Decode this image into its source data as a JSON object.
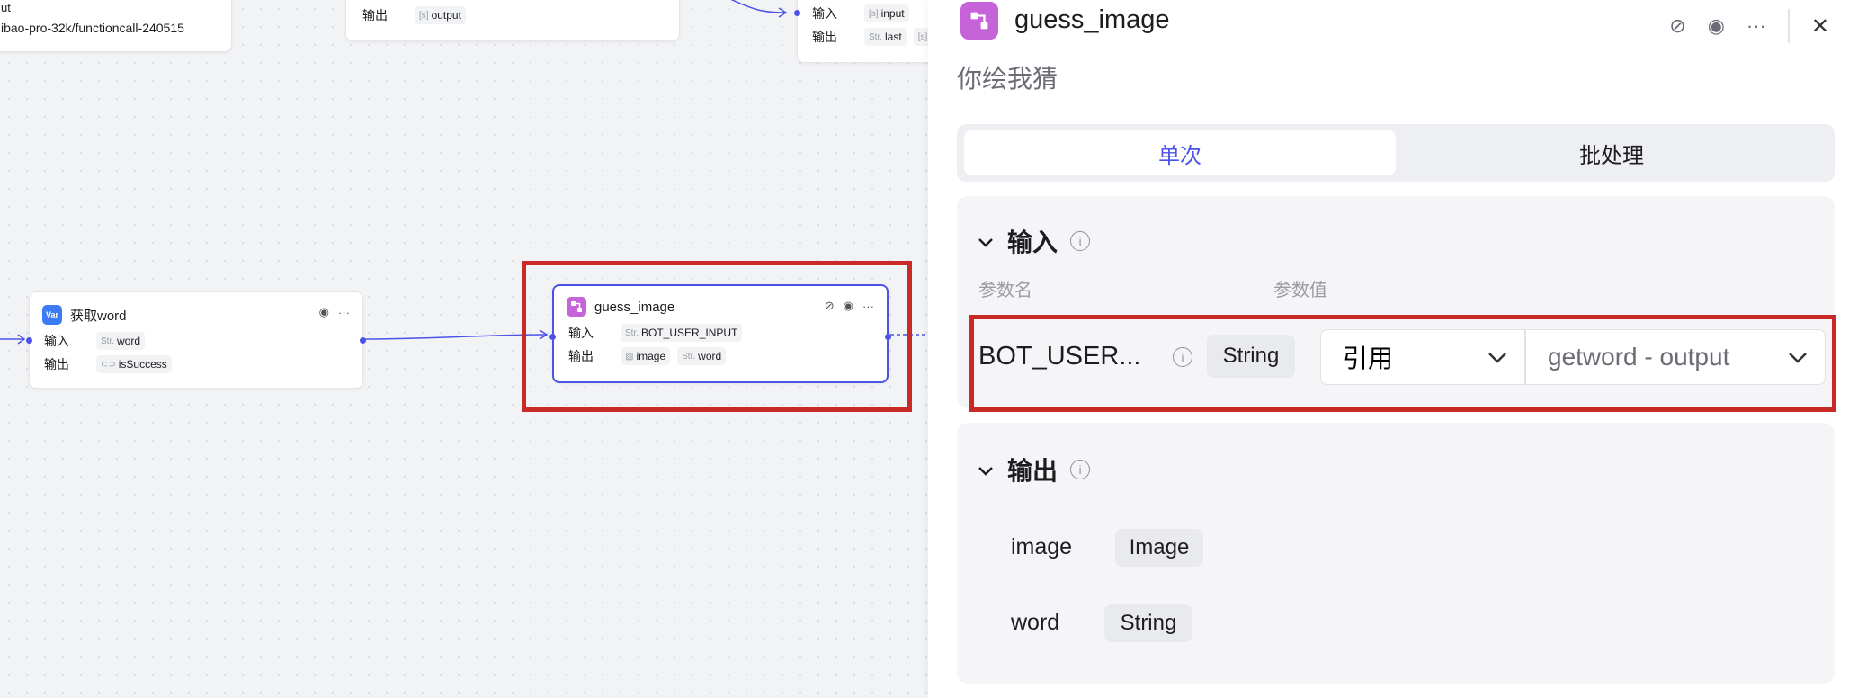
{
  "canvas": {
    "node_top_left": {
      "text": "ibao-pro-32k/functioncall-240515",
      "partial": "ut"
    },
    "node_top_mid": {
      "out_label": "输出",
      "out_value": "output"
    },
    "node_top_right": {
      "in_label": "输入",
      "in_value": "input",
      "out_label": "输出",
      "out_value_1": "last",
      "out_value_2": "a"
    },
    "node_getword": {
      "badge": "Var",
      "title": "获取word",
      "in_label": "输入",
      "in_type": "Str.",
      "in_value": "word",
      "out_label": "输出",
      "out_value": "isSuccess"
    },
    "node_guess": {
      "title": "guess_image",
      "in_label": "输入",
      "in_type": "Str.",
      "in_value": "BOT_USER_INPUT",
      "out_label": "输出",
      "out_value_1": "image",
      "out_type_2": "Str.",
      "out_value_2": "word"
    },
    "type_prefix": "Str."
  },
  "panel": {
    "title": "guess_image",
    "description": "你绘我猜",
    "tabs": {
      "single": "单次",
      "batch": "批处理"
    },
    "input_section": {
      "title": "输入",
      "col_name": "参数名",
      "col_value": "参数值",
      "param_name": "BOT_USER...",
      "param_type": "String",
      "mode": "引用",
      "value": "getword - output"
    },
    "output_section": {
      "title": "输出",
      "items": [
        {
          "name": "image",
          "type": "Image"
        },
        {
          "name": "word",
          "type": "String"
        }
      ]
    }
  },
  "colors": {
    "accent": "#4d53e8",
    "highlight": "#c92a25",
    "plugin": "#c663d9",
    "var": "#3b7cf5"
  }
}
